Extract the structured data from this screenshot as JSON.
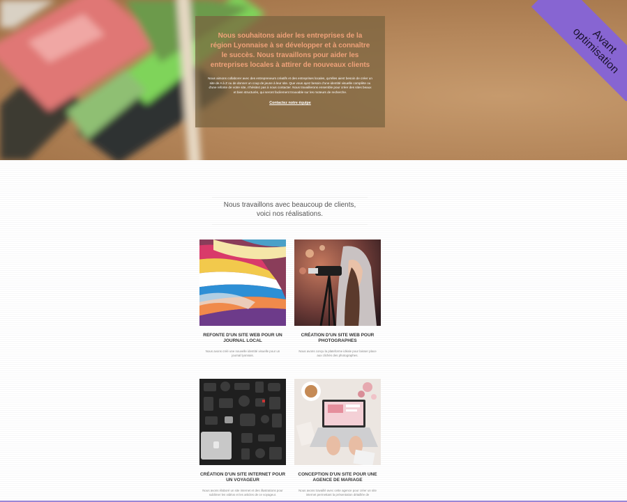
{
  "hero": {
    "heading": "Nous souhaitons aider les entreprises de la région Lyonnaise à se développer et à connaître le succès. Nous travaillons pour aider les entreprises locales à attirer de nouveaux clients",
    "body": "Nous aimons collaborer avec des entrepreneurs créatifs et des entreprises locales, qu'elles aient besoin de créer un site de A à Z ou de donner un coup de jeune à leur site. Que vous ayez besoin d'une identité visuelle complète ou d'une refonte de votre site, n'hésitez pas à nous contacter. Nous travaillerons ensemble pour créer des sites beaux et bien structurés, qui seront facilement trouvable sur les moteurs de recherche.",
    "cta": "Contactez notre équipe"
  },
  "ribbon": {
    "line1": "Avant",
    "line2": "optimisation",
    "color": "#8765d2"
  },
  "intro": {
    "line1": "Nous travaillons avec beaucoup de clients,",
    "line2": "voici nos réalisations."
  },
  "projects": [
    {
      "title": "Refonte d'un site web pour un journal local",
      "desc": "Nous avons créé une nouvelle identité visuelle pour un journal lyonnais.",
      "image": "magazines-photo"
    },
    {
      "title": "Création d'un site web pour photographes",
      "desc": "Nous avons conçu la plateforme idéale pour laisser place aux clichés des photographes.",
      "image": "photographer-photo"
    },
    {
      "title": "Création d'un site internet pour un voyageur",
      "desc": "Nous avons élaboré un site internet et des illustrations pour sublimer les vidéos et les articles de ce voyageur.",
      "image": "gear-flatlay-photo"
    },
    {
      "title": "Conception d'un site pour une agence de mariage",
      "desc": "Nous avons travaillé avec cette agence pour créer un site internet permettant la présentation détaillée de",
      "image": "desk-laptop-photo"
    }
  ]
}
